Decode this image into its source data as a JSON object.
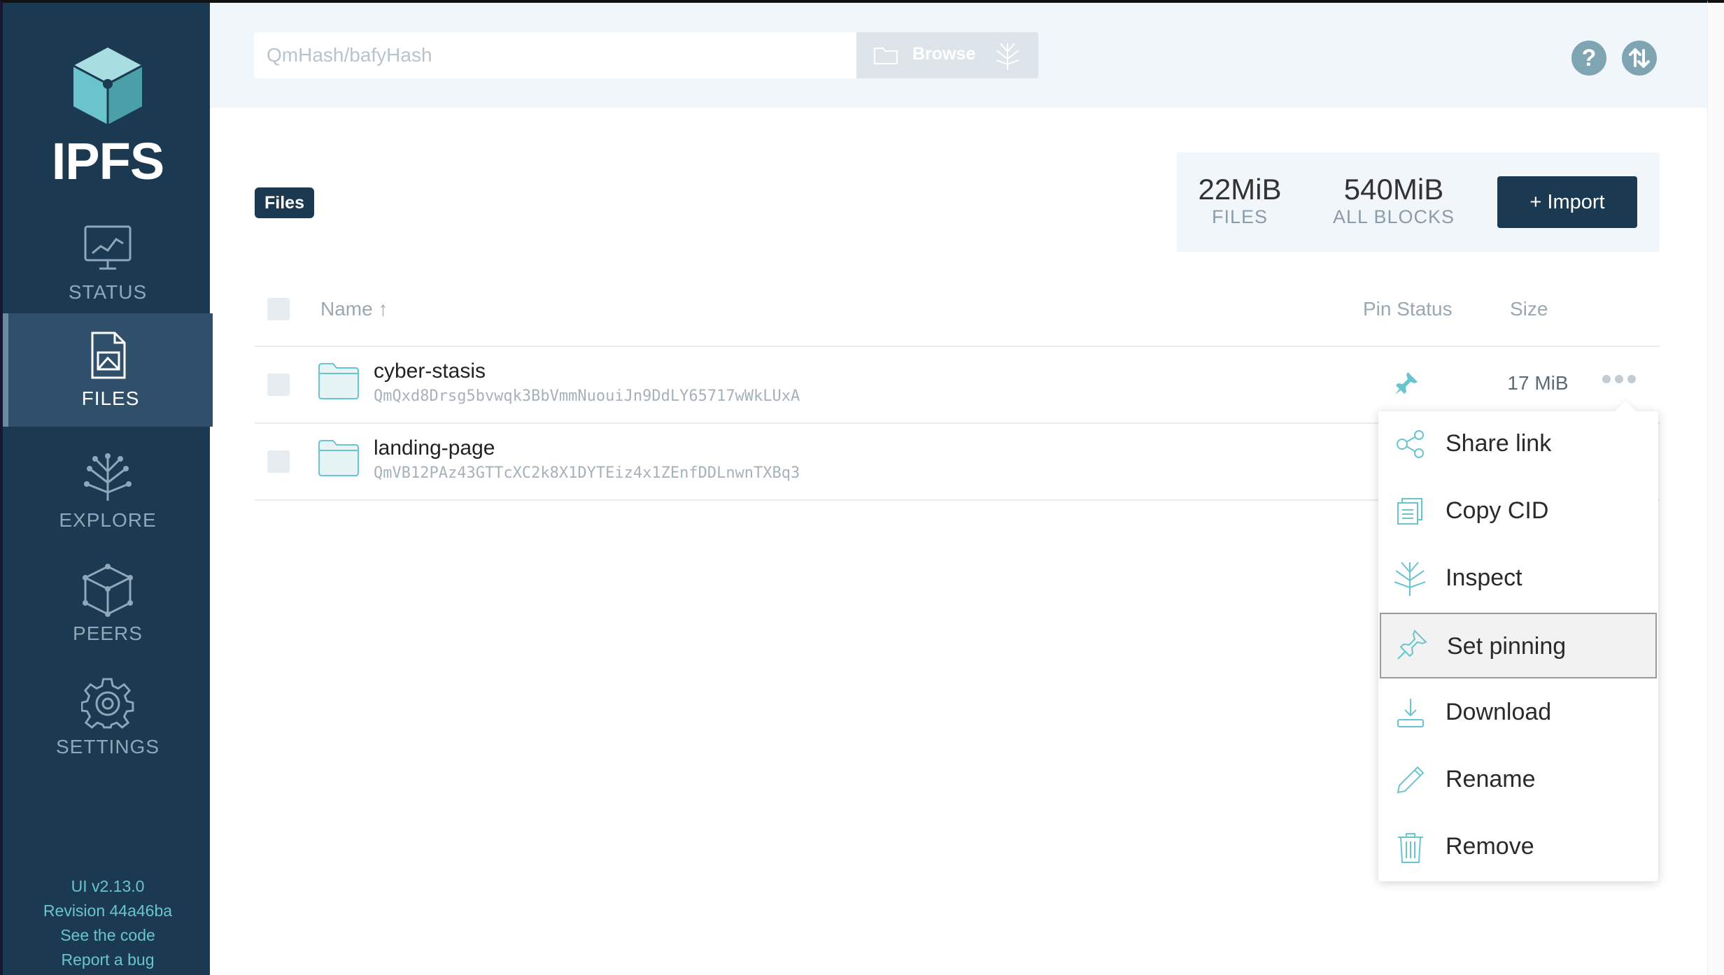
{
  "app": {
    "logo_text": "IPFS"
  },
  "sidebar": {
    "items": [
      {
        "key": "status",
        "label": "STATUS",
        "active": false
      },
      {
        "key": "files",
        "label": "FILES",
        "active": true
      },
      {
        "key": "explore",
        "label": "EXPLORE",
        "active": false
      },
      {
        "key": "peers",
        "label": "PEERS",
        "active": false
      },
      {
        "key": "settings",
        "label": "SETTINGS",
        "active": false
      }
    ],
    "footer": {
      "version": "UI v2.13.0",
      "revision": "Revision 44a46ba",
      "code_link": "See the code",
      "bug_link": "Report a bug"
    }
  },
  "topbar": {
    "search_placeholder": "QmHash/bafyHash",
    "browse_label": "Browse",
    "help_label": "?"
  },
  "breadcrumb": {
    "label": "Files"
  },
  "stats": {
    "files_value": "22MiB",
    "files_label": "FILES",
    "blocks_value": "540MiB",
    "blocks_label": "ALL BLOCKS",
    "import_label": "+ Import"
  },
  "table": {
    "headers": {
      "name": "Name ↑",
      "pin_status": "Pin Status",
      "size": "Size"
    },
    "rows": [
      {
        "name": "cyber-stasis",
        "cid": "QmQxd8Drsg5bvwqk3BbVmmNuouiJn9DdLY65717wWkLUxA",
        "pinned": true,
        "size": "17 MiB"
      },
      {
        "name": "landing-page",
        "cid": "QmVB12PAz43GTTcXC2k8X1DYTEiz4x1ZEnfDDLnwnTXBq3",
        "pinned": false,
        "size": ""
      }
    ]
  },
  "context_menu": {
    "items": [
      {
        "label": "Share link",
        "icon": "share-icon"
      },
      {
        "label": "Copy CID",
        "icon": "copy-icon"
      },
      {
        "label": "Inspect",
        "icon": "inspect-icon"
      },
      {
        "label": "Set pinning",
        "icon": "pin-icon",
        "hovered": true
      },
      {
        "label": "Download",
        "icon": "download-icon"
      },
      {
        "label": "Rename",
        "icon": "pencil-icon"
      },
      {
        "label": "Remove",
        "icon": "trash-icon"
      }
    ]
  },
  "colors": {
    "sidebar_bg": "#1b3a52",
    "sidebar_active_bg": "#2f4f6b",
    "accent_teal": "#69c4cd",
    "topbar_bg": "#f0f6fa",
    "navy_button": "#1b3a52"
  }
}
